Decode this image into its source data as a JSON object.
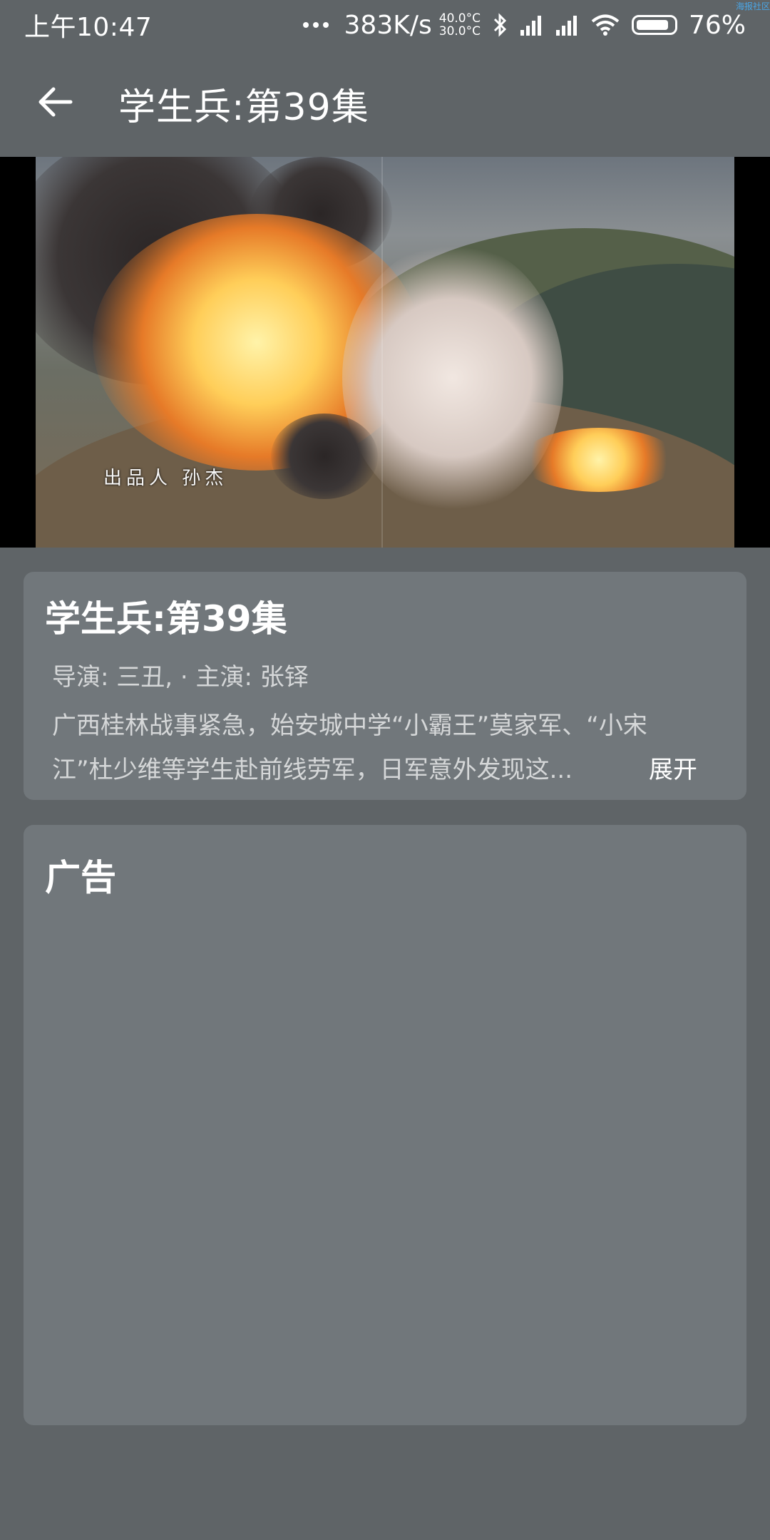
{
  "status_bar": {
    "time": "上午10:47",
    "network_speed": "383K/s",
    "temp_high": "40.0°C",
    "temp_low": "30.0°C",
    "battery": "76%",
    "corner_mark": "海报社区"
  },
  "app_bar": {
    "title": "学生兵:第39集"
  },
  "video": {
    "caption": "出品人 孙杰"
  },
  "info": {
    "title": "学生兵:第39集",
    "meta": "导演: 三丑, · 主演: 张铎",
    "description": "广西桂林战事紧急，始安城中学“小霸王”莫家军、“小宋江”杜少维等学生赴前线劳军，日军意外发现这...",
    "expand_label": "展开"
  },
  "ad": {
    "title": "广告"
  }
}
